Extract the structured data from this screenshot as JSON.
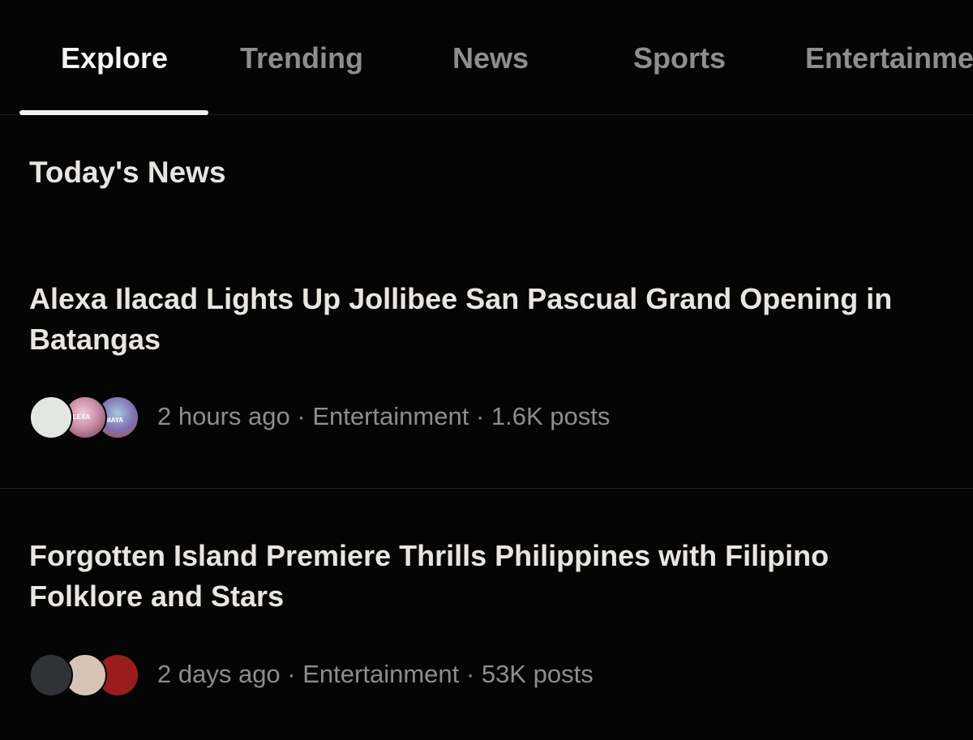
{
  "tabs": {
    "items": [
      "Explore",
      "Trending",
      "News",
      "Sports",
      "Entertainment"
    ],
    "active": "Explore"
  },
  "section": {
    "title": "Today's News"
  },
  "news": [
    {
      "headline": "Alexa Ilacad Lights Up Jollibee San Pascual Grand Opening in Batangas",
      "time": "2 hours ago",
      "category": "Entertainment",
      "posts": "1.6K posts",
      "avatar_colors": [
        "#e4e6e3",
        "#c98fa7",
        "#7d6fb0"
      ],
      "avatar_labels": [
        "",
        "ALEXA",
        "MAYA"
      ]
    },
    {
      "headline": "Forgotten Island Premiere Thrills Philippines with Filipino Folklore and Stars",
      "time": "2 days ago",
      "category": "Entertainment",
      "posts": "53K posts",
      "avatar_colors": [
        "#2f3236",
        "#d9c3b6",
        "#9b1c1c"
      ],
      "avatar_labels": [
        "",
        "",
        ""
      ]
    }
  ],
  "meta_separator": "·"
}
